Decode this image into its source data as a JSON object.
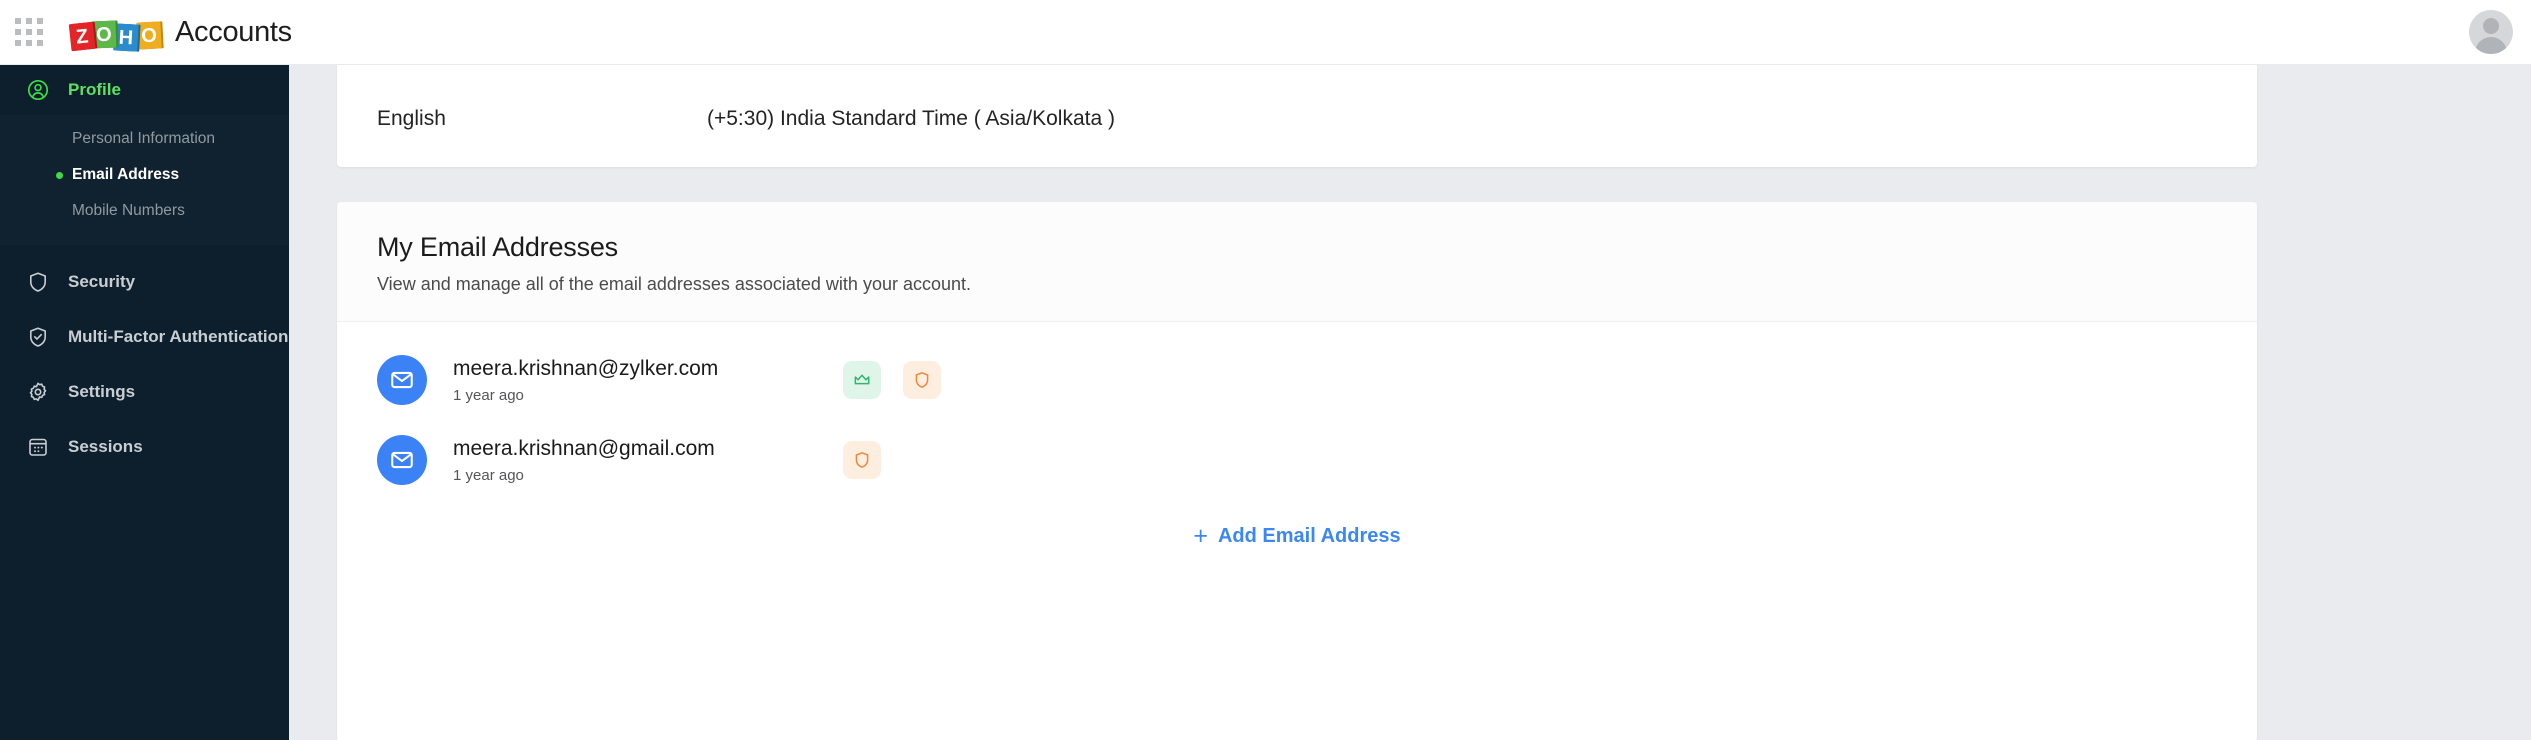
{
  "topbar": {
    "app_grid_icon": "grid-apps-icon",
    "logo_letters": [
      "Z",
      "O",
      "H",
      "O"
    ],
    "logo_colors": [
      "#e42527",
      "#5bb849",
      "#2a8ccc",
      "#f0ad1f"
    ],
    "title": "Accounts",
    "avatar_icon": "user-avatar-icon"
  },
  "sidebar": {
    "bg": "#0d1f2d",
    "accent": "#5ee061",
    "items": [
      {
        "label": "Profile",
        "icon": "user-circle-icon",
        "active": true
      },
      {
        "label": "Security",
        "icon": "shield-icon",
        "active": false
      },
      {
        "label": "Multi-Factor Authentication",
        "icon": "shield-check-icon",
        "active": false
      },
      {
        "label": "Settings",
        "icon": "gear-icon",
        "active": false
      },
      {
        "label": "Sessions",
        "icon": "calendar-grid-icon",
        "active": false
      }
    ],
    "submenu": [
      {
        "label": "Personal Information",
        "current": false
      },
      {
        "label": "Email Address",
        "current": true
      },
      {
        "label": "Mobile Numbers",
        "current": false
      }
    ]
  },
  "main": {
    "locale_card": {
      "language": "English",
      "timezone": "(+5:30) India Standard Time ( Asia/Kolkata )"
    },
    "emails_card": {
      "title": "My Email Addresses",
      "subtitle": "View and manage all of the email addresses associated with your account.",
      "rows": [
        {
          "address": "meera.krishnan@zylker.com",
          "time": "1 year ago",
          "avatar_icon": "envelope-icon",
          "badges": [
            {
              "name": "primary-crown-badge",
              "icon": "crown-icon",
              "bg": "#dff5e8",
              "fg": "#34b36e"
            },
            {
              "name": "verified-shield-badge",
              "icon": "shield-icon",
              "bg": "#fdeedf",
              "fg": "#f2873a"
            }
          ]
        },
        {
          "address": "meera.krishnan@gmail.com",
          "time": "1 year ago",
          "avatar_icon": "envelope-icon",
          "badges": [
            {
              "name": "verified-shield-badge",
              "icon": "shield-icon",
              "bg": "#fdeedf",
              "fg": "#f2873a"
            }
          ]
        }
      ],
      "add_link": "Add Email Address",
      "add_plus": "+",
      "add_color": "#3b88f5"
    }
  }
}
